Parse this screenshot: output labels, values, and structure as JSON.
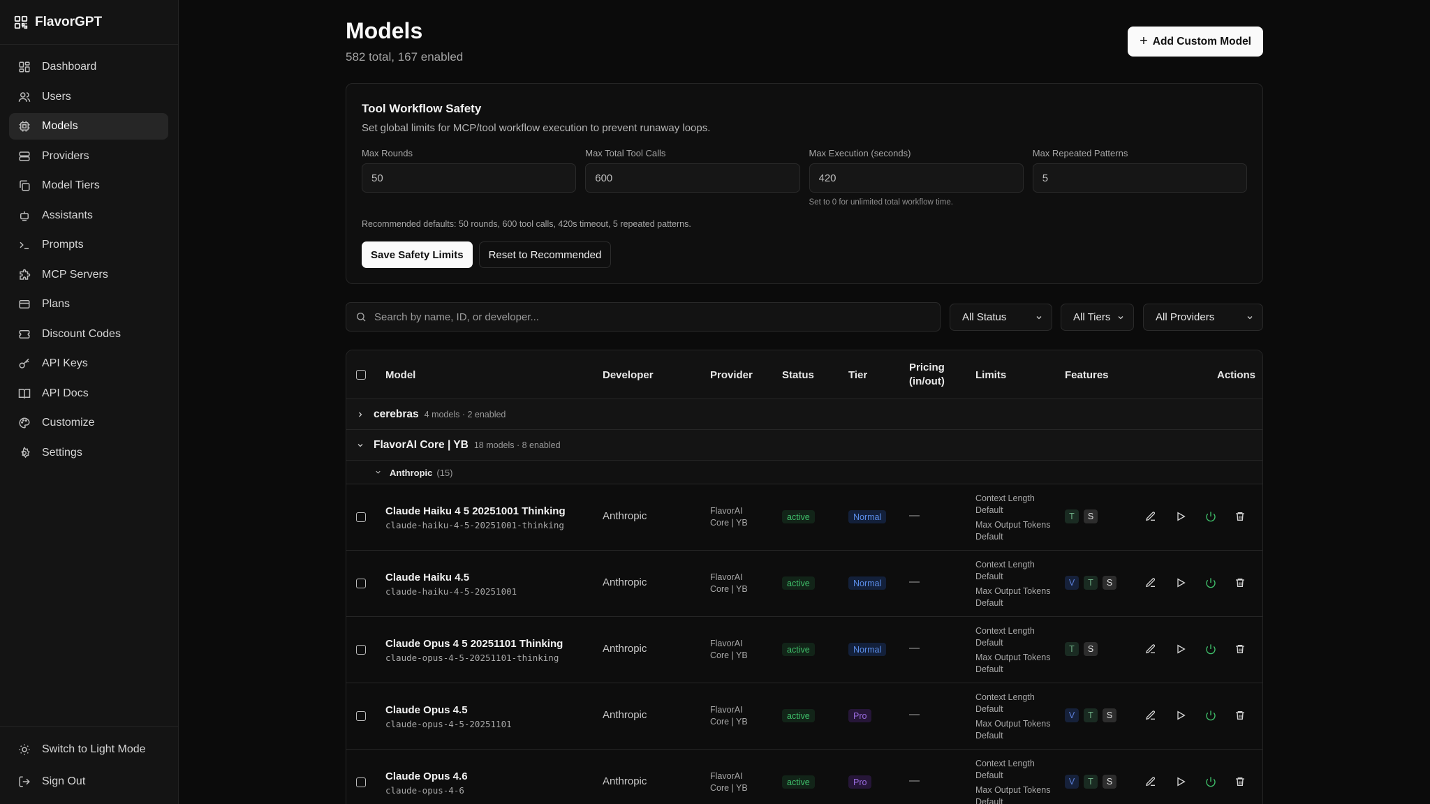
{
  "app": {
    "name": "FlavorGPT"
  },
  "sidebar": {
    "items": [
      {
        "label": "Dashboard",
        "icon": "dashboard-icon"
      },
      {
        "label": "Users",
        "icon": "users-icon"
      },
      {
        "label": "Models",
        "icon": "chip-icon",
        "active": true
      },
      {
        "label": "Providers",
        "icon": "server-icon"
      },
      {
        "label": "Model Tiers",
        "icon": "layers-icon"
      },
      {
        "label": "Assistants",
        "icon": "robot-icon"
      },
      {
        "label": "Prompts",
        "icon": "terminal-icon"
      },
      {
        "label": "MCP Servers",
        "icon": "puzzle-icon"
      },
      {
        "label": "Plans",
        "icon": "credit-card-icon"
      },
      {
        "label": "Discount Codes",
        "icon": "ticket-icon"
      },
      {
        "label": "API Keys",
        "icon": "key-icon"
      },
      {
        "label": "API Docs",
        "icon": "book-icon"
      },
      {
        "label": "Customize",
        "icon": "palette-icon"
      },
      {
        "label": "Settings",
        "icon": "gear-icon"
      }
    ],
    "bottom": {
      "theme_toggle": "Switch to Light Mode",
      "sign_out": "Sign Out"
    }
  },
  "header": {
    "title": "Models",
    "subtitle": "582 total, 167 enabled",
    "add_button": "Add Custom Model"
  },
  "safety": {
    "title": "Tool Workflow Safety",
    "description": "Set global limits for MCP/tool workflow execution to prevent runaway loops.",
    "fields": [
      {
        "label": "Max Rounds",
        "value": "50"
      },
      {
        "label": "Max Total Tool Calls",
        "value": "600"
      },
      {
        "label": "Max Execution (seconds)",
        "value": "420",
        "hint": "Set to 0 for unlimited total workflow time."
      },
      {
        "label": "Max Repeated Patterns",
        "value": "5"
      }
    ],
    "recommended": "Recommended defaults: 50 rounds, 600 tool calls, 420s timeout, 5 repeated patterns.",
    "save_button": "Save Safety Limits",
    "reset_button": "Reset to Recommended"
  },
  "filters": {
    "search_placeholder": "Search by name, ID, or developer...",
    "status": "All Status",
    "tiers": "All Tiers",
    "providers": "All Providers"
  },
  "table": {
    "columns": {
      "model": "Model",
      "developer": "Developer",
      "provider": "Provider",
      "status": "Status",
      "tier": "Tier",
      "pricing": "Pricing (in/out)",
      "limits": "Limits",
      "features": "Features",
      "actions": "Actions"
    },
    "groups": [
      {
        "name": "cerebras",
        "meta": "4 models · 2 enabled",
        "expanded": false
      },
      {
        "name": "FlavorAI Core | YB",
        "meta": "18 models · 8 enabled",
        "expanded": true
      }
    ],
    "subgroup": {
      "name": "Anthropic",
      "count": "(15)"
    },
    "rows": [
      {
        "name": "Claude Haiku 4 5 20251001 Thinking",
        "id": "claude-haiku-4-5-20251001-thinking",
        "developer": "Anthropic",
        "provider": "FlavorAI Core | YB",
        "status": "active",
        "tier": "Normal",
        "pricing": "—",
        "limits_a": "Context Length Default",
        "limits_b": "Max Output Tokens Default",
        "features": [
          "T",
          "S"
        ]
      },
      {
        "name": "Claude Haiku 4.5",
        "id": "claude-haiku-4-5-20251001",
        "developer": "Anthropic",
        "provider": "FlavorAI Core | YB",
        "status": "active",
        "tier": "Normal",
        "pricing": "—",
        "limits_a": "Context Length Default",
        "limits_b": "Max Output Tokens Default",
        "features": [
          "V",
          "T",
          "S"
        ]
      },
      {
        "name": "Claude Opus 4 5 20251101 Thinking",
        "id": "claude-opus-4-5-20251101-thinking",
        "developer": "Anthropic",
        "provider": "FlavorAI Core | YB",
        "status": "active",
        "tier": "Normal",
        "pricing": "—",
        "limits_a": "Context Length Default",
        "limits_b": "Max Output Tokens Default",
        "features": [
          "T",
          "S"
        ]
      },
      {
        "name": "Claude Opus 4.5",
        "id": "claude-opus-4-5-20251101",
        "developer": "Anthropic",
        "provider": "FlavorAI Core | YB",
        "status": "active",
        "tier": "Pro",
        "pricing": "—",
        "limits_a": "Context Length Default",
        "limits_b": "Max Output Tokens Default",
        "features": [
          "V",
          "T",
          "S"
        ]
      },
      {
        "name": "Claude Opus 4.6",
        "id": "claude-opus-4-6",
        "developer": "Anthropic",
        "provider": "FlavorAI Core | YB",
        "status": "active",
        "tier": "Pro",
        "pricing": "—",
        "limits_a": "Context Length Default",
        "limits_b": "Max Output Tokens Default",
        "features": [
          "V",
          "T",
          "S"
        ]
      }
    ]
  },
  "colors": {
    "background": "#0b0b0b",
    "sidebar": "#141414",
    "active_green": "#3fbf6a",
    "normal_blue": "#5b8de8",
    "pro_purple": "#9b6ce0"
  }
}
